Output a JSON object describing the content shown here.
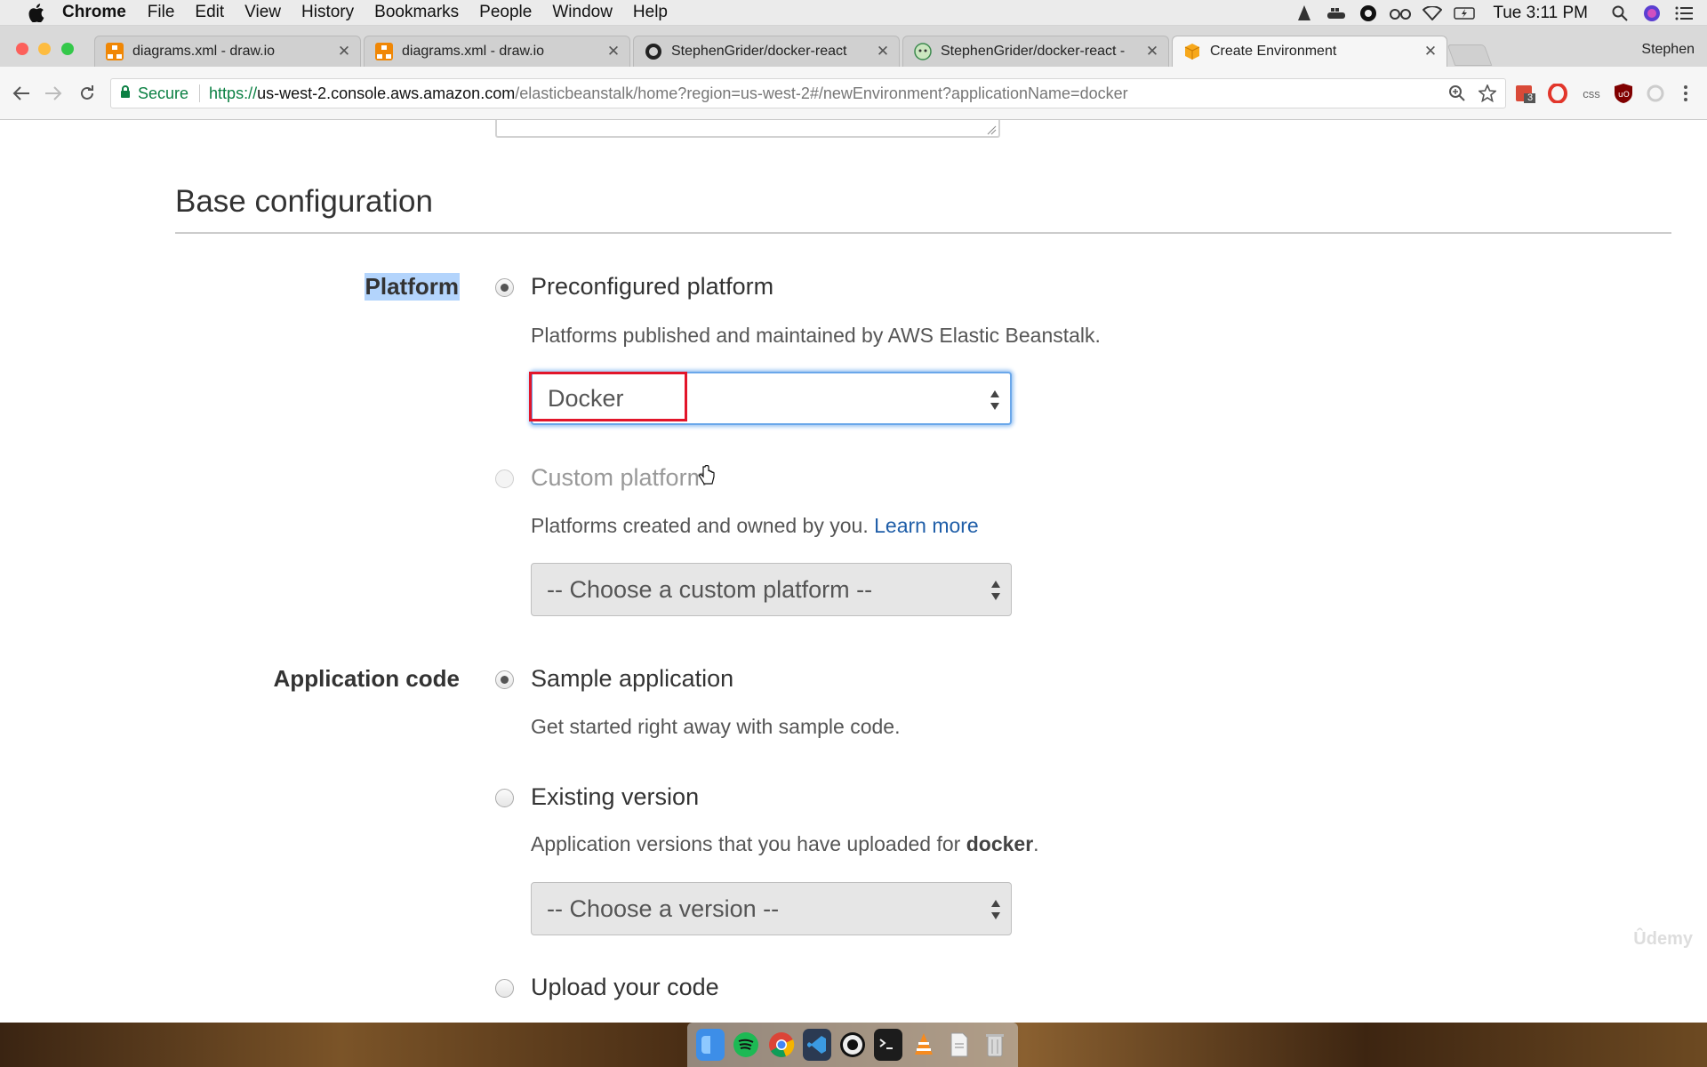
{
  "menubar": {
    "app": "Chrome",
    "items": [
      "File",
      "Edit",
      "View",
      "History",
      "Bookmarks",
      "People",
      "Window",
      "Help"
    ],
    "clock": "Tue 3:11 PM"
  },
  "browser": {
    "tabs": [
      {
        "title": "diagrams.xml - draw.io",
        "icon": "drawio-icon"
      },
      {
        "title": "diagrams.xml - draw.io",
        "icon": "drawio-icon"
      },
      {
        "title": "StephenGrider/docker-react",
        "icon": "github-icon"
      },
      {
        "title": "StephenGrider/docker-react -",
        "icon": "travis-icon"
      },
      {
        "title": "Create Environment",
        "icon": "aws-cube-icon"
      }
    ],
    "profile": "Stephen",
    "address": {
      "secure_label": "Secure",
      "scheme": "https://",
      "host": "us-west-2.console.aws.amazon.com",
      "path": "/elasticbeanstalk/home?region=us-west-2#/newEnvironment?applicationName=docker"
    },
    "extension_badge": "3",
    "extension_css_label": "css"
  },
  "page": {
    "section_title": "Base configuration",
    "platform": {
      "label": "Platform",
      "preconfigured": {
        "label": "Preconfigured platform",
        "description": "Platforms published and maintained by AWS Elastic Beanstalk.",
        "selected_value": "Docker",
        "checked": true
      },
      "custom": {
        "label": "Custom platform",
        "description": "Platforms created and owned by you.",
        "learn_more": "Learn more",
        "select_placeholder": "-- Choose a custom platform --",
        "checked": false
      }
    },
    "application_code": {
      "label": "Application code",
      "sample": {
        "label": "Sample application",
        "description": "Get started right away with sample code.",
        "checked": true
      },
      "existing": {
        "label": "Existing version",
        "description_prefix": "Application versions that you have uploaded for ",
        "app_name": "docker",
        "description_suffix": ".",
        "select_placeholder": "-- Choose a version --",
        "checked": false
      },
      "upload": {
        "label": "Upload your code",
        "checked": false
      }
    },
    "watermark": "Ûdemy"
  },
  "dock": {
    "apps": [
      "finder-icon",
      "spotify-icon",
      "chrome-icon",
      "vscode-icon",
      "obs-icon",
      "terminal-icon",
      "vlc-icon",
      "document-icon",
      "trash-icon"
    ]
  },
  "colors": {
    "link": "#1f5ea8",
    "highlight_box": "#e2152a",
    "focus_ring": "#6aa7ea",
    "secure_green": "#0b8043",
    "label_selection": "#b3d4fc"
  }
}
